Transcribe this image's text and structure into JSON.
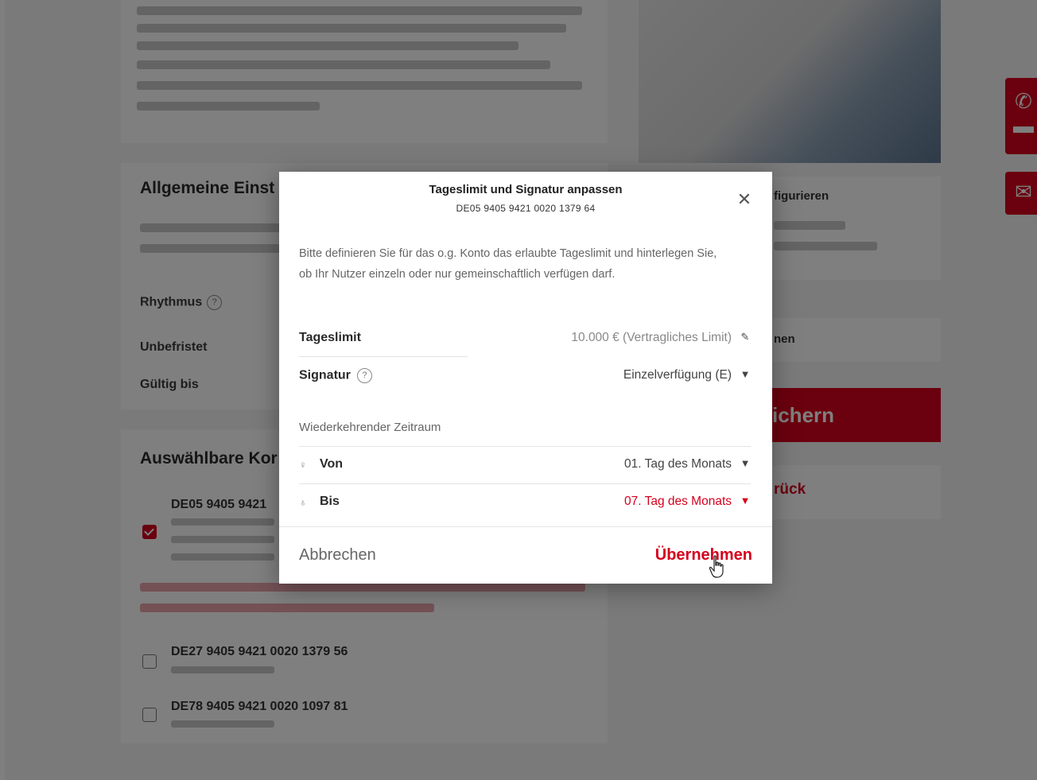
{
  "background": {
    "settings_title": "Allgemeine Einst",
    "rhythm_label": "Rhythmus",
    "unlimited_label": "Unbefristet",
    "valid_until_label": "Gültig bis",
    "accounts_title": "Auswählbare Kor",
    "accounts": [
      {
        "iban": "DE05 9405 9421",
        "checked": true
      },
      {
        "iban": "DE27 9405 9421 0020 1379 56",
        "checked": false
      },
      {
        "iban": "DE78 9405 9421 0020 1097 81",
        "checked": false
      }
    ],
    "right": {
      "config_title": "figurieren",
      "field_text": "nen",
      "save_label": "ichern",
      "back_label": "rück"
    }
  },
  "modal": {
    "title": "Tageslimit und Signatur anpassen",
    "subtitle": "DE05 9405 9421 0020 1379 64",
    "description": "Bitte definieren Sie für das o.g. Konto das erlaubte Tageslimit und hinterlegen Sie, ob Ihr Nutzer einzeln oder nur gemeinschaftlich verfügen darf.",
    "rows": {
      "limit": {
        "label": "Tageslimit",
        "value": "10.000 € (Vertragliches Limit)",
        "icon": "pencil-icon"
      },
      "signature": {
        "label": "Signatur",
        "value": "Einzelverfügung (E)",
        "icon": "caret-down-icon"
      }
    },
    "period_label": "Wiederkehrender Zeitraum",
    "from": {
      "label": "Von",
      "value": "01. Tag des Monats"
    },
    "to": {
      "label": "Bis",
      "value": "07. Tag des Monats"
    },
    "cancel_label": "Abbrechen",
    "apply_label": "Übernehmen"
  },
  "colors": {
    "accent": "#d6001c",
    "overlay": "rgba(0,0,0,0.5)"
  }
}
